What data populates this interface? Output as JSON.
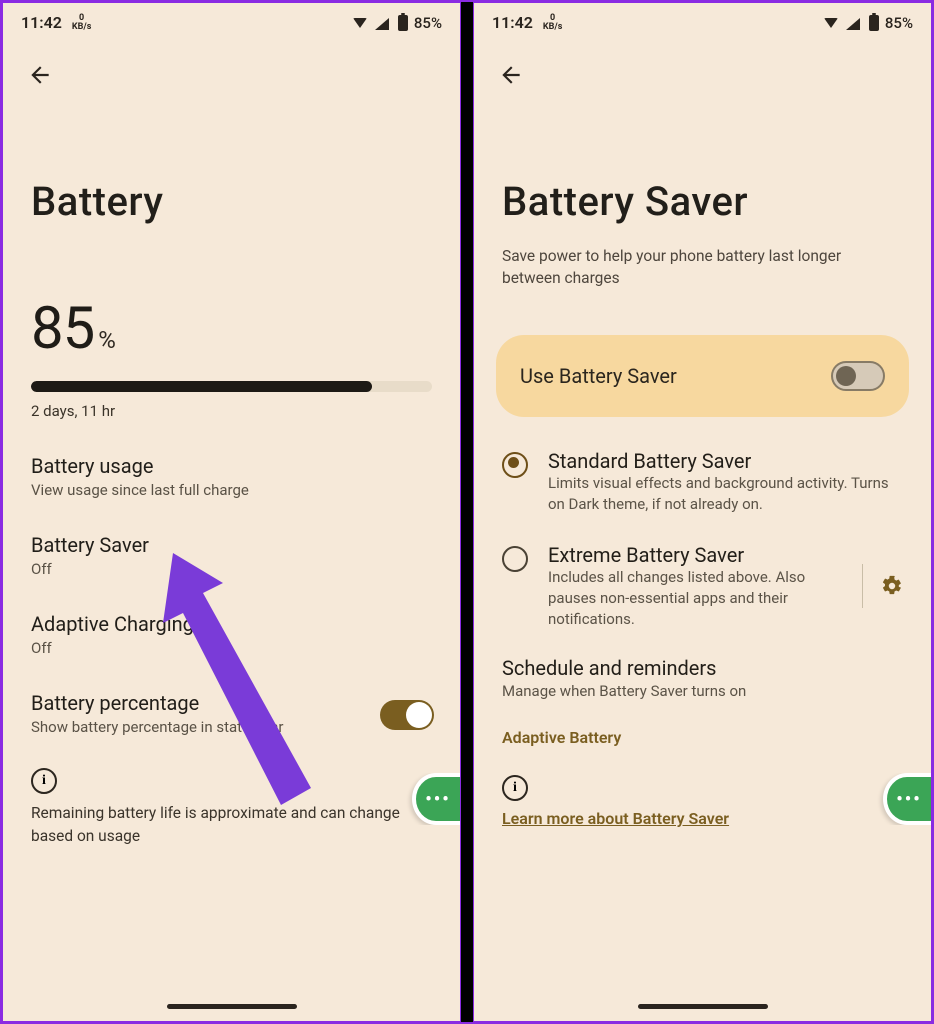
{
  "status": {
    "time": "11:42",
    "net_rate_value": "0",
    "net_rate_unit": "KB/s",
    "battery_pct": "85%"
  },
  "left": {
    "title": "Battery",
    "percent_value": "85",
    "percent_unit": "%",
    "estimate": "2 days, 11 hr",
    "fill_pct": 85,
    "items": {
      "usage": {
        "title": "Battery usage",
        "desc": "View usage since last full charge"
      },
      "saver": {
        "title": "Battery Saver",
        "desc": "Off"
      },
      "adapt": {
        "title": "Adaptive Charging",
        "desc": "Off"
      },
      "pct": {
        "title": "Battery percentage",
        "desc": "Show battery percentage in status bar"
      }
    },
    "note": "Remaining battery life is approximate and can change based on usage"
  },
  "right": {
    "title": "Battery Saver",
    "intro": "Save power to help your phone battery last longer between charges",
    "toggle_label": "Use Battery Saver",
    "options": {
      "standard": {
        "title": "Standard Battery Saver",
        "desc": "Limits visual effects and background activity. Turns on Dark theme, if not already on."
      },
      "extreme": {
        "title": "Extreme Battery Saver",
        "desc": "Includes all changes listed above. Also pauses non-essential apps and their notifications."
      }
    },
    "schedule": {
      "title": "Schedule and reminders",
      "desc": "Manage when Battery Saver turns on"
    },
    "adaptive_label": "Adaptive Battery",
    "learn_more": "Learn more about Battery Saver"
  }
}
